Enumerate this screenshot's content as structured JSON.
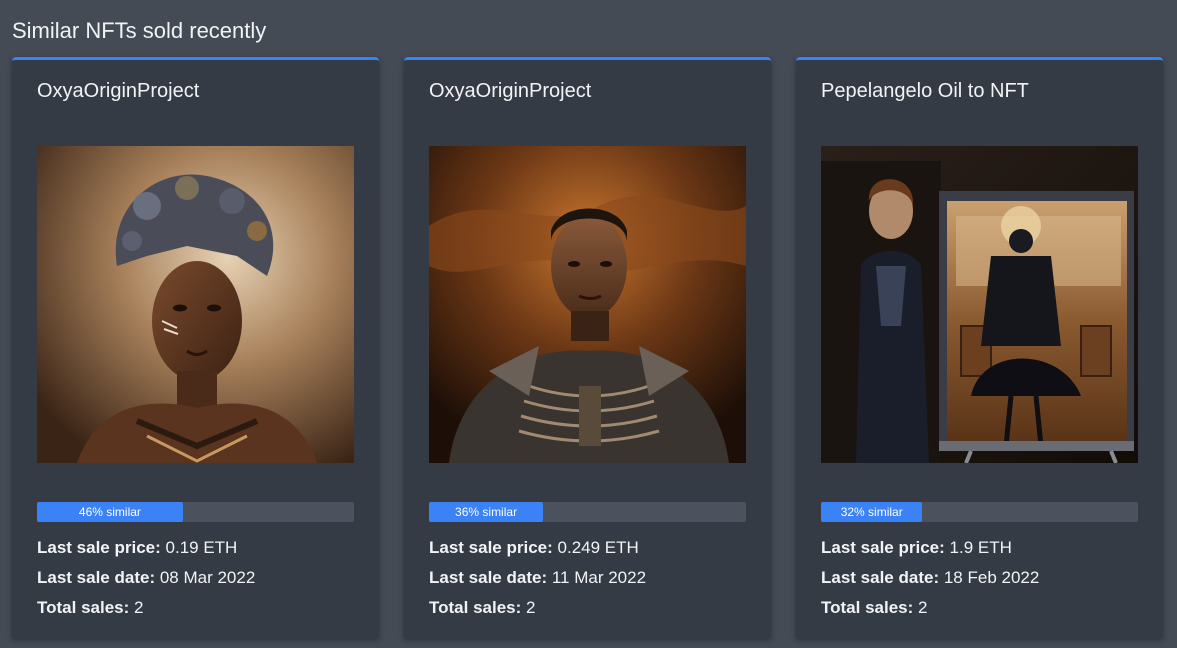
{
  "section_title": "Similar NFTs sold recently",
  "accent_color": "#3b82f6",
  "cards": [
    {
      "title": "OxyaOriginProject",
      "image": "nft-portrait-woman-headdress",
      "similarity": 0.46,
      "similarity_label": "46% similar",
      "price_label": "Last sale price:",
      "price_value": "0.19 ETH",
      "date_label": "Last sale date:",
      "date_value": "08 Mar 2022",
      "sales_label": "Total sales:",
      "sales_value": "2"
    },
    {
      "title": "OxyaOriginProject",
      "image": "nft-portrait-man-armor",
      "similarity": 0.36,
      "similarity_label": "36% similar",
      "price_label": "Last sale price:",
      "price_value": "0.249 ETH",
      "date_label": "Last sale date:",
      "date_value": "11 Mar 2022",
      "sales_label": "Total sales:",
      "sales_value": "2"
    },
    {
      "title": "Pepelangelo Oil to NFT",
      "image": "nft-oil-painting-easel",
      "similarity": 0.32,
      "similarity_label": "32% similar",
      "price_label": "Last sale price:",
      "price_value": "1.9 ETH",
      "date_label": "Last sale date:",
      "date_value": "18 Feb 2022",
      "sales_label": "Total sales:",
      "sales_value": "2"
    }
  ]
}
